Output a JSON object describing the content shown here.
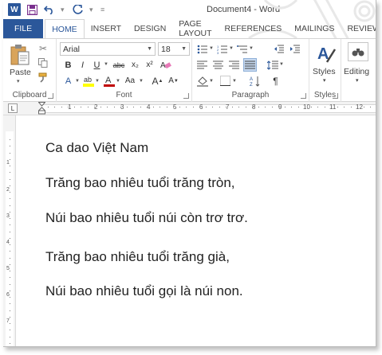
{
  "window": {
    "title": "Document4 - Word"
  },
  "quick_access": {
    "undo_icon": "undo-icon",
    "redo_icon": "redo-icon",
    "save_icon": "save-icon"
  },
  "tabs": [
    "FILE",
    "HOME",
    "INSERT",
    "DESIGN",
    "PAGE LAYOUT",
    "REFERENCES",
    "MAILINGS",
    "REVIEW"
  ],
  "active_tab": "HOME",
  "ribbon": {
    "clipboard": {
      "label": "Clipboard",
      "paste_label": "Paste"
    },
    "font": {
      "label": "Font",
      "font_name": "Arial",
      "font_size": "18",
      "bold": "B",
      "italic": "I",
      "underline": "U",
      "strike": "abc",
      "sub": "x₂",
      "sup": "x²",
      "grow": "A",
      "shrink": "A",
      "case": "Aa"
    },
    "paragraph": {
      "label": "Paragraph",
      "pilcrow": "¶"
    },
    "styles": {
      "label": "Styles",
      "button_label": "Styles"
    },
    "editing": {
      "button_label": "Editing"
    }
  },
  "ruler": {
    "marks": [
      "1",
      "2",
      "3",
      "4",
      "5",
      "6",
      "7",
      "8",
      "9",
      "10",
      "11",
      "12"
    ],
    "tab_selector": "L"
  },
  "vruler": {
    "marks": [
      "1",
      "2",
      "3",
      "4",
      "5",
      "6",
      "7"
    ]
  },
  "document": {
    "paragraphs": [
      "Ca dao Việt Nam",
      "Trăng bao nhiêu tuổi trăng tròn,",
      "Núi bao nhiêu tuổi núi còn trơ trơ.",
      "Trăng bao nhiêu tuổi trăng già,",
      "Núi bao nhiêu tuổi gọi là núi non."
    ]
  },
  "colors": {
    "accent": "#2b579a",
    "selected": "#c5d7ee"
  }
}
